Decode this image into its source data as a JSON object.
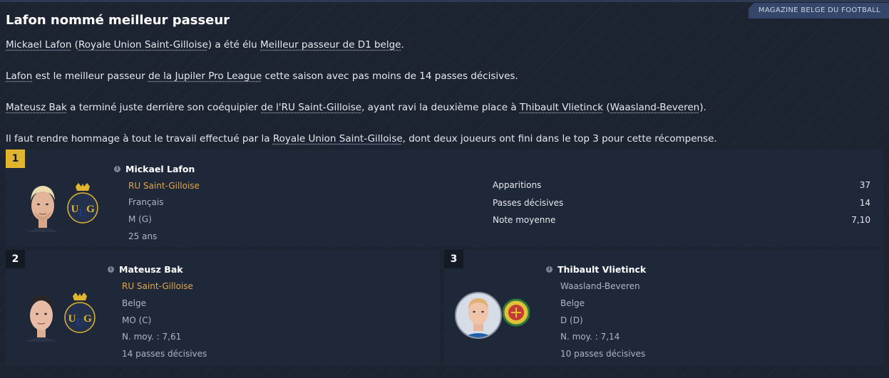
{
  "source": "MAGAZINE BELGE DU FOOTBALL",
  "title": "Lafon nommé meilleur passeur",
  "paragraphs": {
    "p1": {
      "player": "Mickael Lafon",
      "open": " (",
      "club": "Royale Union Saint-Gilloise",
      "mid": ") a été élu ",
      "award": "Meilleur passeur de D1 belge",
      "end": "."
    },
    "p2": {
      "player": "Lafon",
      "mid": " est le meilleur passeur ",
      "league": "de la Jupiler Pro League",
      "end": " cette saison avec pas moins de 14 passes décisives."
    },
    "p3": {
      "player": "Mateusz Bak",
      "mid": " a terminé juste derrière son coéquipier ",
      "club": "de l'RU Saint-Gilloise",
      "mid2": ", ayant ravi la deuxième place à ",
      "player2": "Thibault Vlietinck",
      "open": " (",
      "club2": "Waasland-Beveren",
      "end": ")."
    },
    "p4": {
      "start": "Il faut rendre hommage à tout le travail effectué par la ",
      "club": "Royale Union Saint-Gilloise",
      "end": ", dont deux joueurs ont fini dans le top 3 pour cette récompense."
    }
  },
  "winners": [
    {
      "rank": "1",
      "name": "Mickael Lafon",
      "club": "RU Saint-Gilloise",
      "nationality": "Français",
      "position": "M (G)",
      "age": "25 ans",
      "stats": [
        {
          "label": "Apparitions",
          "value": "37"
        },
        {
          "label": "Passes décisives",
          "value": "14"
        },
        {
          "label": "Note moyenne",
          "value": "7,10"
        }
      ]
    },
    {
      "rank": "2",
      "name": "Mateusz Bak",
      "club": "RU Saint-Gilloise",
      "nationality": "Belge",
      "position": "MO (C)",
      "rating": "N. moy. : 7,61",
      "assists": "14 passes décisives"
    },
    {
      "rank": "3",
      "name": "Thibault Vlietinck",
      "club": "Waasland-Beveren",
      "nationality": "Belge",
      "position": "D (D)",
      "rating": "N. moy. : 7,14",
      "assists": "10 passes décisives"
    }
  ],
  "info_glyph": "i",
  "colors": {
    "gold": "#e2b52e",
    "club_link": "#e2a64a",
    "background": "#1c2432"
  }
}
